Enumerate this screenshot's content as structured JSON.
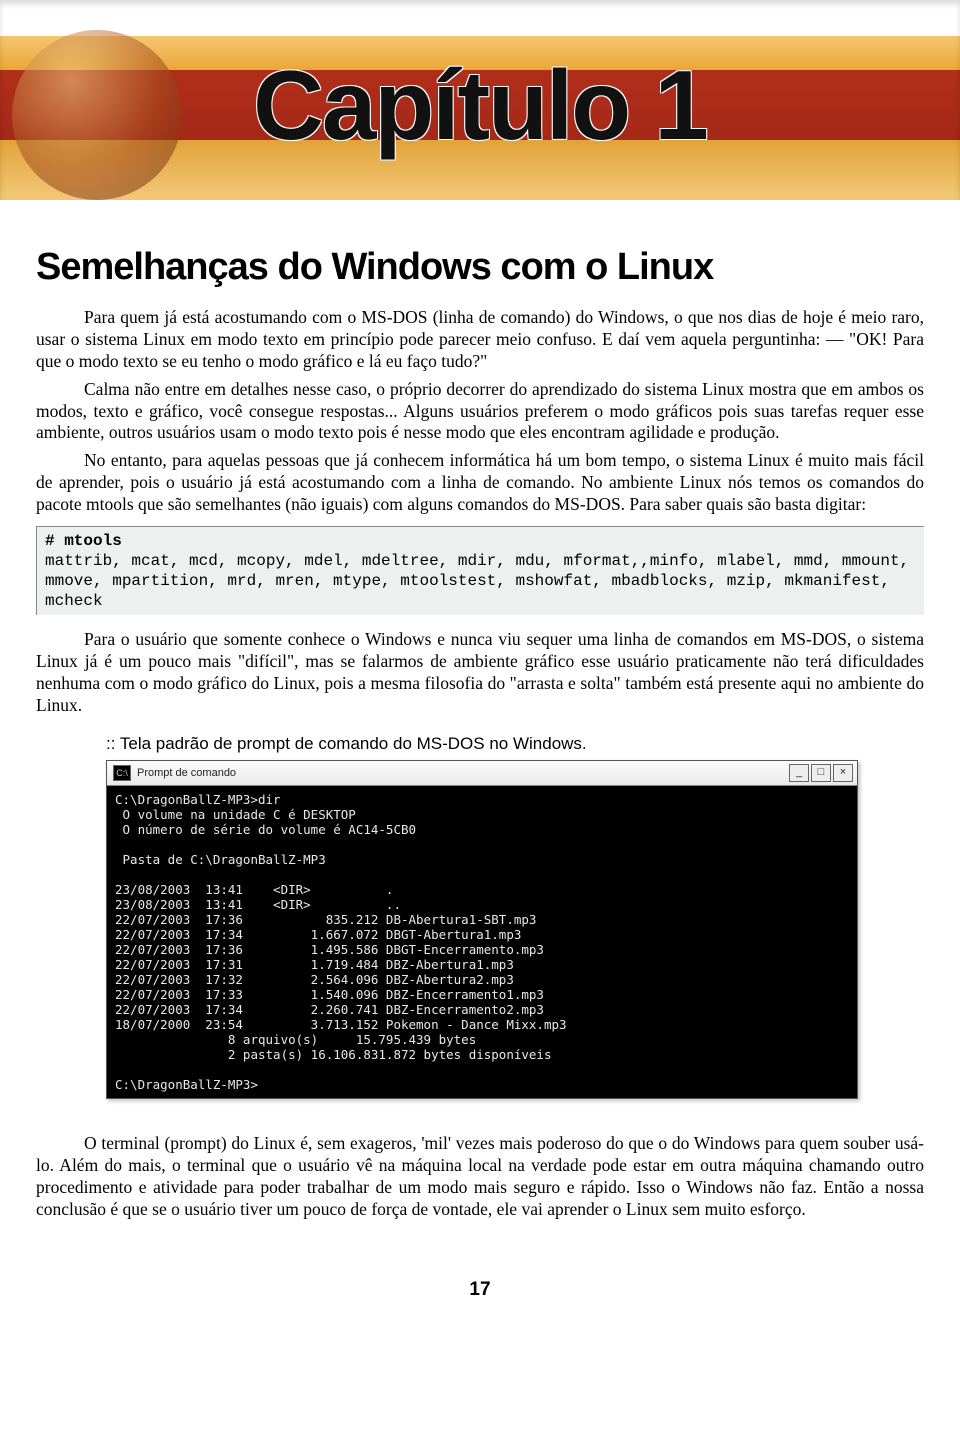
{
  "banner": {
    "title": "Capítulo 1"
  },
  "section": {
    "title": "Semelhanças do Windows com o Linux"
  },
  "paragraphs": {
    "p1": "Para quem já está acostumando com o MS-DOS (linha de comando) do Windows, o que nos dias de hoje é meio raro,  usar o sistema Linux em modo texto em princípio pode parecer meio confuso. E daí vem aquela perguntinha: ― \"OK! Para que o modo texto se eu tenho o modo gráfico e lá eu faço tudo?\"",
    "p2": "Calma não entre em detalhes nesse caso, o próprio decorrer do aprendizado do sistema Linux mostra que em ambos os modos, texto e gráfico, você consegue respostas... Alguns usuários preferem o modo gráficos pois suas tarefas requer esse ambiente, outros usuários usam o modo texto pois é nesse modo que eles encontram agilidade e produção.",
    "p3": "No entanto,  para aquelas pessoas que já conhecem informática há um bom tempo, o sistema Linux é muito mais fácil de aprender, pois o usuário já está acostumando com a linha de comando. No ambiente Linux nós temos os comandos do pacote mtools que são semelhantes (não iguais) com alguns comandos do MS-DOS. Para saber quais são basta digitar:",
    "p4": "Para o usuário que somente conhece o Windows e nunca viu sequer uma linha de comandos em MS-DOS, o sistema Linux já é um pouco mais \"difícil\", mas se falarmos de ambiente gráfico esse usuário praticamente não terá dificuldades nenhuma com o modo gráfico do Linux, pois a mesma filosofia do \"arrasta e solta\" também está presente aqui no ambiente do Linux.",
    "p5": "O terminal (prompt) do Linux é, sem exageros, 'mil' vezes mais poderoso do que o do Windows para quem souber usá-lo. Além do mais, o terminal que o usuário vê na máquina local na verdade pode estar em outra máquina chamando outro procedimento e atividade para poder trabalhar de um modo mais seguro e rápido. Isso o Windows não faz. Então a nossa conclusão é que se o usuário tiver um pouco de força de vontade, ele vai aprender o Linux sem muito esforço."
  },
  "code": {
    "cmd": "# mtools",
    "body": "mattrib, mcat, mcd, mcopy, mdel, mdeltree, mdir, mdu, mformat,,minfo, mlabel, mmd, mmount, mmove, mpartition, mrd, mren, mtype, mtoolstest, mshowfat, mbadblocks, mzip, mkmanifest, mcheck"
  },
  "caption": ":: Tela padrão de prompt de comando do MS-DOS no Windows.",
  "terminal": {
    "title": "Prompt de comando",
    "icon_label": "C:\\",
    "btn_min": "_",
    "btn_max": "□",
    "btn_close": "×",
    "lines": "C:\\DragonBallZ-MP3>dir\n O volume na unidade C é DESKTOP\n O número de série do volume é AC14-5CB0\n\n Pasta de C:\\DragonBallZ-MP3\n\n23/08/2003  13:41    <DIR>          .\n23/08/2003  13:41    <DIR>          ..\n22/07/2003  17:36           835.212 DB-Abertura1-SBT.mp3\n22/07/2003  17:34         1.667.072 DBGT-Abertura1.mp3\n22/07/2003  17:36         1.495.586 DBGT-Encerramento.mp3\n22/07/2003  17:31         1.719.484 DBZ-Abertura1.mp3\n22/07/2003  17:32         2.564.096 DBZ-Abertura2.mp3\n22/07/2003  17:33         1.540.096 DBZ-Encerramento1.mp3\n22/07/2003  17:34         2.260.741 DBZ-Encerramento2.mp3\n18/07/2000  23:54         3.713.152 Pokemon - Dance Mixx.mp3\n               8 arquivo(s)     15.795.439 bytes\n               2 pasta(s) 16.106.831.872 bytes disponíveis\n\nC:\\DragonBallZ-MP3>"
  },
  "page_number": "17"
}
